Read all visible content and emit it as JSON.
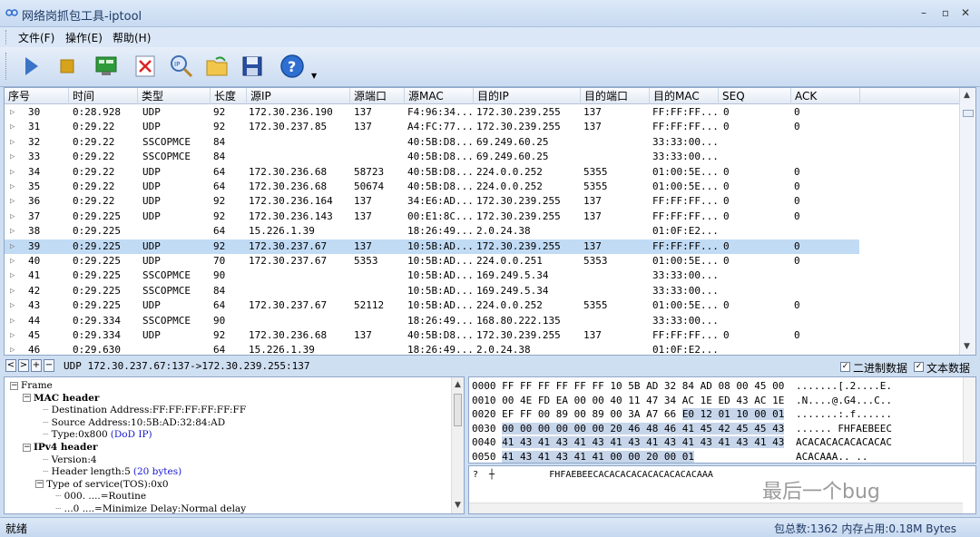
{
  "window": {
    "title": "网络岗抓包工具-iptool",
    "min": "–",
    "max": "▫",
    "close": "✕"
  },
  "menu": [
    "文件(F)",
    "操作(E)",
    "帮助(H)"
  ],
  "toolbar": {
    "buttons": [
      "start-icon",
      "stop-icon",
      "network-card-icon",
      "clear-icon",
      "ip-search-icon",
      "open-folder-icon",
      "save-icon",
      "help-icon"
    ]
  },
  "list": {
    "headers": [
      "序号",
      "时间",
      "类型",
      "长度",
      "源IP",
      "源端口",
      "源MAC",
      "目的IP",
      "目的端口",
      "目的MAC",
      "SEQ",
      "ACK"
    ],
    "rows": [
      [
        "30",
        "0:28.928",
        "UDP",
        "92",
        "172.30.236.190",
        "137",
        "F4:96:34...",
        "172.30.239.255",
        "137",
        "FF:FF:FF...",
        "0",
        "0"
      ],
      [
        "31",
        "0:29.22",
        "UDP",
        "92",
        "172.30.237.85",
        "137",
        "A4:FC:77...",
        "172.30.239.255",
        "137",
        "FF:FF:FF...",
        "0",
        "0"
      ],
      [
        "32",
        "0:29.22",
        "SSCOPMCE",
        "84",
        "",
        "",
        "40:5B:D8...",
        "69.249.60.25",
        "",
        "33:33:00...",
        "",
        ""
      ],
      [
        "33",
        "0:29.22",
        "SSCOPMCE",
        "84",
        "",
        "",
        "40:5B:D8...",
        "69.249.60.25",
        "",
        "33:33:00...",
        "",
        ""
      ],
      [
        "34",
        "0:29.22",
        "UDP",
        "64",
        "172.30.236.68",
        "58723",
        "40:5B:D8...",
        "224.0.0.252",
        "5355",
        "01:00:5E...",
        "0",
        "0"
      ],
      [
        "35",
        "0:29.22",
        "UDP",
        "64",
        "172.30.236.68",
        "50674",
        "40:5B:D8...",
        "224.0.0.252",
        "5355",
        "01:00:5E...",
        "0",
        "0"
      ],
      [
        "36",
        "0:29.22",
        "UDP",
        "92",
        "172.30.236.164",
        "137",
        "34:E6:AD...",
        "172.30.239.255",
        "137",
        "FF:FF:FF...",
        "0",
        "0"
      ],
      [
        "37",
        "0:29.225",
        "UDP",
        "92",
        "172.30.236.143",
        "137",
        "00:E1:8C...",
        "172.30.239.255",
        "137",
        "FF:FF:FF...",
        "0",
        "0"
      ],
      [
        "38",
        "0:29.225",
        "",
        "64",
        "15.226.1.39",
        "",
        "18:26:49...",
        "2.0.24.38",
        "",
        "01:0F:E2...",
        "",
        ""
      ],
      [
        "39",
        "0:29.225",
        "UDP",
        "92",
        "172.30.237.67",
        "137",
        "10:5B:AD...",
        "172.30.239.255",
        "137",
        "FF:FF:FF...",
        "0",
        "0"
      ],
      [
        "40",
        "0:29.225",
        "UDP",
        "70",
        "172.30.237.67",
        "5353",
        "10:5B:AD...",
        "224.0.0.251",
        "5353",
        "01:00:5E...",
        "0",
        "0"
      ],
      [
        "41",
        "0:29.225",
        "SSCOPMCE",
        "90",
        "",
        "",
        "10:5B:AD...",
        "169.249.5.34",
        "",
        "33:33:00...",
        "",
        ""
      ],
      [
        "42",
        "0:29.225",
        "SSCOPMCE",
        "84",
        "",
        "",
        "10:5B:AD...",
        "169.249.5.34",
        "",
        "33:33:00...",
        "",
        ""
      ],
      [
        "43",
        "0:29.225",
        "UDP",
        "64",
        "172.30.237.67",
        "52112",
        "10:5B:AD...",
        "224.0.0.252",
        "5355",
        "01:00:5E...",
        "0",
        "0"
      ],
      [
        "44",
        "0:29.334",
        "SSCOPMCE",
        "90",
        "",
        "",
        "18:26:49...",
        "168.80.222.135",
        "",
        "33:33:00...",
        "",
        ""
      ],
      [
        "45",
        "0:29.334",
        "UDP",
        "92",
        "172.30.236.68",
        "137",
        "40:5B:D8...",
        "172.30.239.255",
        "137",
        "FF:FF:FF...",
        "0",
        "0"
      ],
      [
        "46",
        "0:29.630",
        "",
        "64",
        "15.226.1.39",
        "",
        "18:26:49...",
        "2.0.24.38",
        "",
        "01:0F:E2...",
        "",
        ""
      ]
    ],
    "selected_row": "39"
  },
  "nav": {
    "buttons": [
      "<",
      ">",
      "+",
      "−"
    ],
    "summary": "UDP 172.30.237.67:137->172.30.239.255:137",
    "chk_binary": "二进制数据",
    "chk_text": "文本数据",
    "check": "✓"
  },
  "tree": [
    {
      "box": "−",
      "label": "Frame",
      "bold": false,
      "indent": 0
    },
    {
      "box": "−",
      "label": "MAC header",
      "bold": true,
      "indent": 1
    },
    {
      "box": "",
      "label": "Destination Address:FF:FF:FF:FF:FF:FF",
      "bold": false,
      "indent": 2
    },
    {
      "box": "",
      "label": "Source Address:10:5B:AD:32:84:AD",
      "bold": false,
      "indent": 2
    },
    {
      "box": "",
      "label": "Type:0x800",
      "extra": "(DoD IP)",
      "bold": false,
      "indent": 2
    },
    {
      "box": "−",
      "label": "IPv4 header",
      "bold": true,
      "indent": 1
    },
    {
      "box": "",
      "label": "Version:4",
      "bold": false,
      "indent": 2
    },
    {
      "box": "",
      "label": "Header length:5",
      "extra": "(20 bytes)",
      "bold": false,
      "indent": 2
    },
    {
      "box": "−",
      "label": "Type of service(TOS):0x0",
      "bold": false,
      "indent": 2
    },
    {
      "box": "",
      "label": "000. ....=Routine",
      "bold": false,
      "indent": 3
    },
    {
      "box": "",
      "label": "...0 ....=Minimize Delay:Normal delay",
      "bold": false,
      "indent": 3
    }
  ],
  "hex": [
    {
      "off": "0000",
      "pre": "FF FF FF FF FF FF 10 5B AD 32 84 AD 08 00 45 00",
      "hl": "",
      "ascii": ".......[.2....E."
    },
    {
      "off": "0010",
      "pre": "00 4E FD EA 00 00 40 11 47 34 AC 1E ED 43 AC 1E",
      "hl": "",
      "ascii": ".N....@.G4...C.."
    },
    {
      "off": "0020",
      "pre": "EF FF 00 89 00 89 00 3A A7 66 ",
      "hl": "E0 12 01 10 00 01",
      "ascii": ".......:.f......"
    },
    {
      "off": "0030",
      "pre": "",
      "hl": "00 00 00 00 00 00 20 46 48 46 41 45 42 45 45 43",
      "ascii": "...... FHFAEBEEC"
    },
    {
      "off": "0040",
      "pre": "",
      "hl": "41 43 41 43 41 43 41 43 41 43 41 43 41 43 41 43",
      "ascii": "ACACACACACACACAC"
    },
    {
      "off": "0050",
      "pre": "",
      "hl": "41 43 41 43 41 41 00 00 20 00 01",
      "ascii": "ACACAAA.. .."
    }
  ],
  "text_view": "?  ┼          FHFAEBEECACACACACACACACACACAAA",
  "watermark": "最后一个bug",
  "status": {
    "left": "就绪",
    "right": "包总数:1362  内存占用:0.18M Bytes"
  }
}
